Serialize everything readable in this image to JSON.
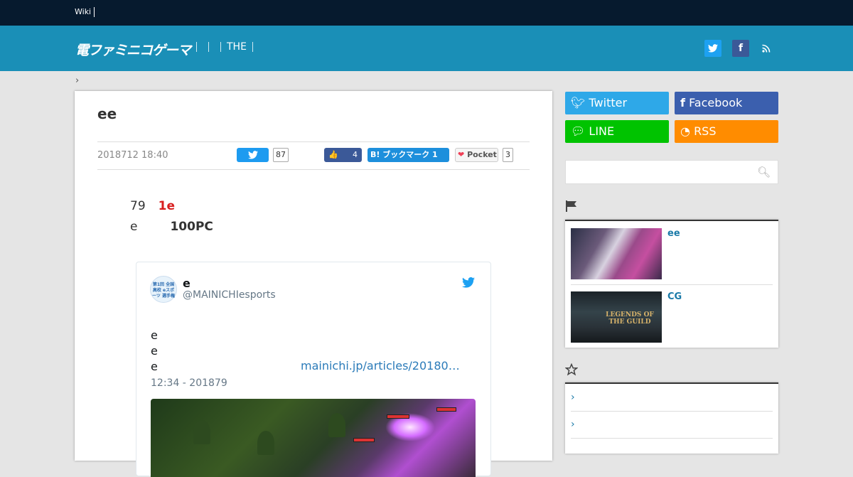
{
  "topbar": {
    "wiki_label": "Wiki"
  },
  "header": {
    "logo_text": "電ファミニコゲーマ",
    "nav_items": [
      "",
      "",
      "THE"
    ],
    "twitter_icon": "twitter-icon",
    "facebook_icon": "facebook-icon",
    "rss_icon": "rss-icon"
  },
  "breadcrumb": {
    "separator": "›"
  },
  "article": {
    "title": "ee",
    "date": "2018712 18:40",
    "share": {
      "twitter_count": "87",
      "facebook_count": "4",
      "hatena_label": "B! ブックマーク 1",
      "pocket_label": "Pocket",
      "pocket_count": "3"
    },
    "body_line1_prefix": "79",
    "body_line1_highlight": "1e",
    "body_line2_prefix": "e",
    "body_line2_bold": "100PC",
    "tweet": {
      "user_name": "e",
      "handle": "@MAINICHIesports",
      "lines": [
        "e",
        "e",
        "e"
      ],
      "link": "mainichi.jp/articles/20180…",
      "time": "12:34 - 201879",
      "avatar_text": "第1回 全国高校 eスポーツ 選手権"
    }
  },
  "sidebar": {
    "buttons": {
      "twitter": "Twitter",
      "facebook": "Facebook",
      "line": "LINE",
      "rss": "RSS"
    },
    "search_placeholder": "",
    "widget1": {
      "icon": "flag-icon",
      "items": [
        {
          "title": "ee"
        },
        {
          "title": "CG",
          "thumb_text": "LEGENDS OF THE GUILD"
        }
      ]
    },
    "widget2": {
      "icon": "star-icon",
      "items": [
        "›",
        "›"
      ]
    }
  }
}
